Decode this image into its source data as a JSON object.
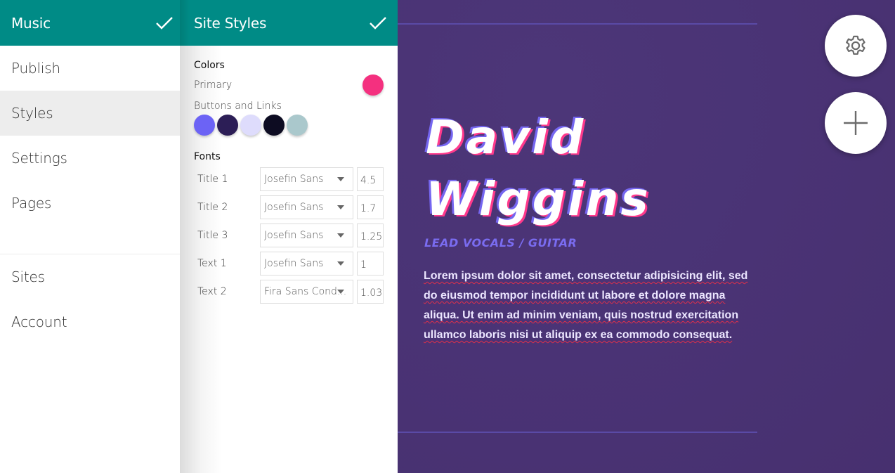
{
  "sidebar": {
    "title": "Music",
    "items": [
      {
        "label": "Publish",
        "active": false
      },
      {
        "label": "Styles",
        "active": true
      },
      {
        "label": "Settings",
        "active": false
      },
      {
        "label": "Pages",
        "active": false
      }
    ],
    "bottom_items": [
      {
        "label": "Sites"
      },
      {
        "label": "Account"
      }
    ]
  },
  "panel": {
    "title": "Site Styles",
    "colors_title": "Colors",
    "primary_label": "Primary",
    "primary_color": "#f4307f",
    "buttons_links_label": "Buttons and Links",
    "swatches": [
      "#6c63f5",
      "#2c1e56",
      "#dedcfc",
      "#0d0c22",
      "#aac8cc"
    ],
    "fonts_title": "Fonts",
    "fonts": [
      {
        "label": "Title 1",
        "font": "Josefin Sans",
        "size": "4.5"
      },
      {
        "label": "Title 2",
        "font": "Josefin Sans",
        "size": "1.7"
      },
      {
        "label": "Title 3",
        "font": "Josefin Sans",
        "size": "1.25"
      },
      {
        "label": "Text 1",
        "font": "Josefin Sans",
        "size": "1"
      },
      {
        "label": "Text 2",
        "font": "Fira Sans Cond...",
        "size": "1.03"
      }
    ]
  },
  "preview": {
    "name_line1": "David",
    "name_line2": "Wiggins",
    "subtitle": "LEAD VOCALS / GUITAR",
    "body": "Lorem ipsum dolor sit amet, consectetur adipisicing elit, sed do eiusmod tempor incididunt ut labore et dolore magna aliqua. Ut enim ad minim veniam, quis nostrud exercitation ullamco laboris nisi ut aliquip ex ea commodo consequat."
  },
  "fabs": {
    "settings_icon": "gear-icon",
    "add_icon": "plus-icon"
  },
  "colors": {
    "header_teal": "#008b86",
    "background_purple": "#4a3375",
    "accent_blue": "#7566f0",
    "accent_pink": "#ff3a8c"
  }
}
